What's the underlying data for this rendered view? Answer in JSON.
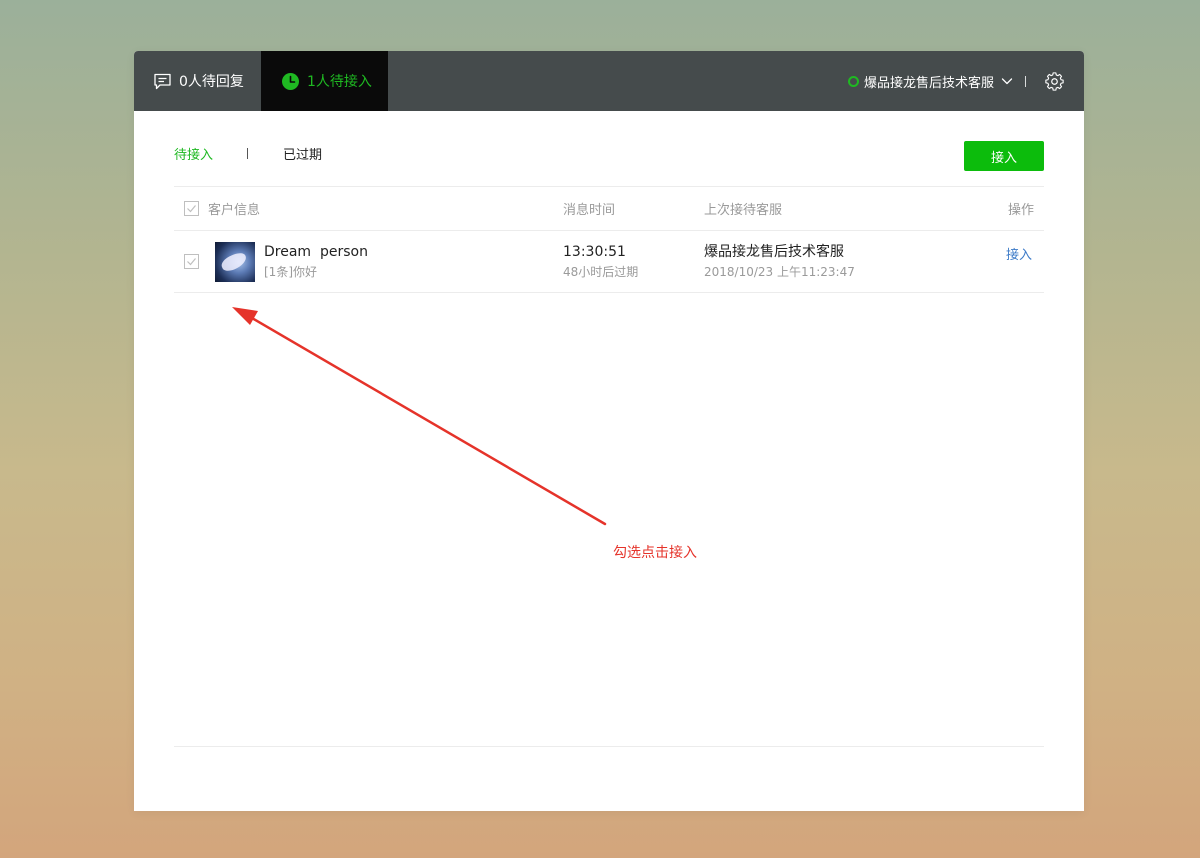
{
  "header": {
    "tab_reply": "0人待回复",
    "tab_pending": "1人待接入",
    "agent_name": "爆品接龙售后技术客服"
  },
  "subtabs": {
    "pending": "待接入",
    "expired": "已过期"
  },
  "accept_button": "接入",
  "table": {
    "columns": {
      "customer": "客户信息",
      "time": "消息时间",
      "last_agent": "上次接待客服",
      "action": "操作"
    },
    "rows": [
      {
        "name": "Dream  person",
        "message": "[1条]你好",
        "time": "13:30:51",
        "expire": "48小时后过期",
        "last_agent": "爆品接龙售后技术客服",
        "last_time": "2018/10/23 上午11:23:47",
        "action": "接入"
      }
    ]
  },
  "annotation": "勾选点击接入",
  "colors": {
    "accent_green": "#1fb922",
    "button_green": "#0cbc0c",
    "topbar": "#454b4c",
    "link_blue": "#3d7bc8",
    "annotation_red": "#e5332a"
  },
  "icons": {
    "reply_tab": "chat-bubble-icon",
    "pending_tab": "clock-icon",
    "status": "online-status-icon",
    "dropdown": "chevron-down-icon",
    "settings": "gear-icon",
    "checkbox": "checkmark-icon",
    "annotation": "arrow-icon"
  }
}
